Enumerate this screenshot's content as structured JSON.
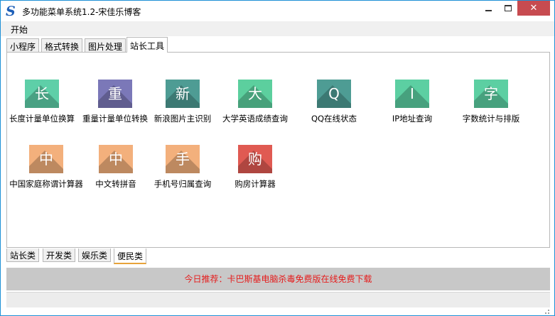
{
  "window": {
    "title": "多功能菜单系统1.2-宋佳乐博客",
    "app_icon_letter": "S"
  },
  "menu": {
    "items": [
      "开始"
    ]
  },
  "top_tabs": [
    {
      "label": "小程序",
      "active": false
    },
    {
      "label": "格式转换",
      "active": false
    },
    {
      "label": "图片处理",
      "active": false
    },
    {
      "label": "站长工具",
      "active": true
    }
  ],
  "tools": [
    {
      "glyph": "长",
      "label": "长度计量单位换算",
      "color": "#5ecfa8"
    },
    {
      "glyph": "重",
      "label": "重量计量单位转换",
      "color": "#7b78b8"
    },
    {
      "glyph": "新",
      "label": "新浪图片主识别",
      "color": "#4e9c94"
    },
    {
      "glyph": "大",
      "label": "大学英语成绩查询",
      "color": "#5ccf9e"
    },
    {
      "glyph": "Q",
      "label": "QQ在线状态",
      "color": "#4e9c94"
    },
    {
      "glyph": "I",
      "label": "IP地址查询",
      "color": "#5ccfa2"
    },
    {
      "glyph": "字",
      "label": "字数统计与排版",
      "color": "#5ccfa2"
    },
    {
      "glyph": "中",
      "label": "中国家庭称谓计算器",
      "color": "#f3b07c"
    },
    {
      "glyph": "中",
      "label": "中文转拼音",
      "color": "#f3b07c"
    },
    {
      "glyph": "手",
      "label": "手机号归属查询",
      "color": "#f3b07c"
    },
    {
      "glyph": "购",
      "label": "购房计算器",
      "color": "#e05a52"
    }
  ],
  "bottom_tabs": [
    {
      "label": "站长类",
      "active": false
    },
    {
      "label": "开发类",
      "active": false
    },
    {
      "label": "娱乐类",
      "active": false
    },
    {
      "label": "便民类",
      "active": true
    }
  ],
  "recommendation": {
    "text": "今日推荐：卡巴斯基电脑杀毒免费版在线免费下载"
  },
  "colors": {
    "window_border": "#1e90d6",
    "close_button": "#c74b50",
    "reco_text": "#e51c1c",
    "active_tab_underline": "#e8a33a"
  }
}
